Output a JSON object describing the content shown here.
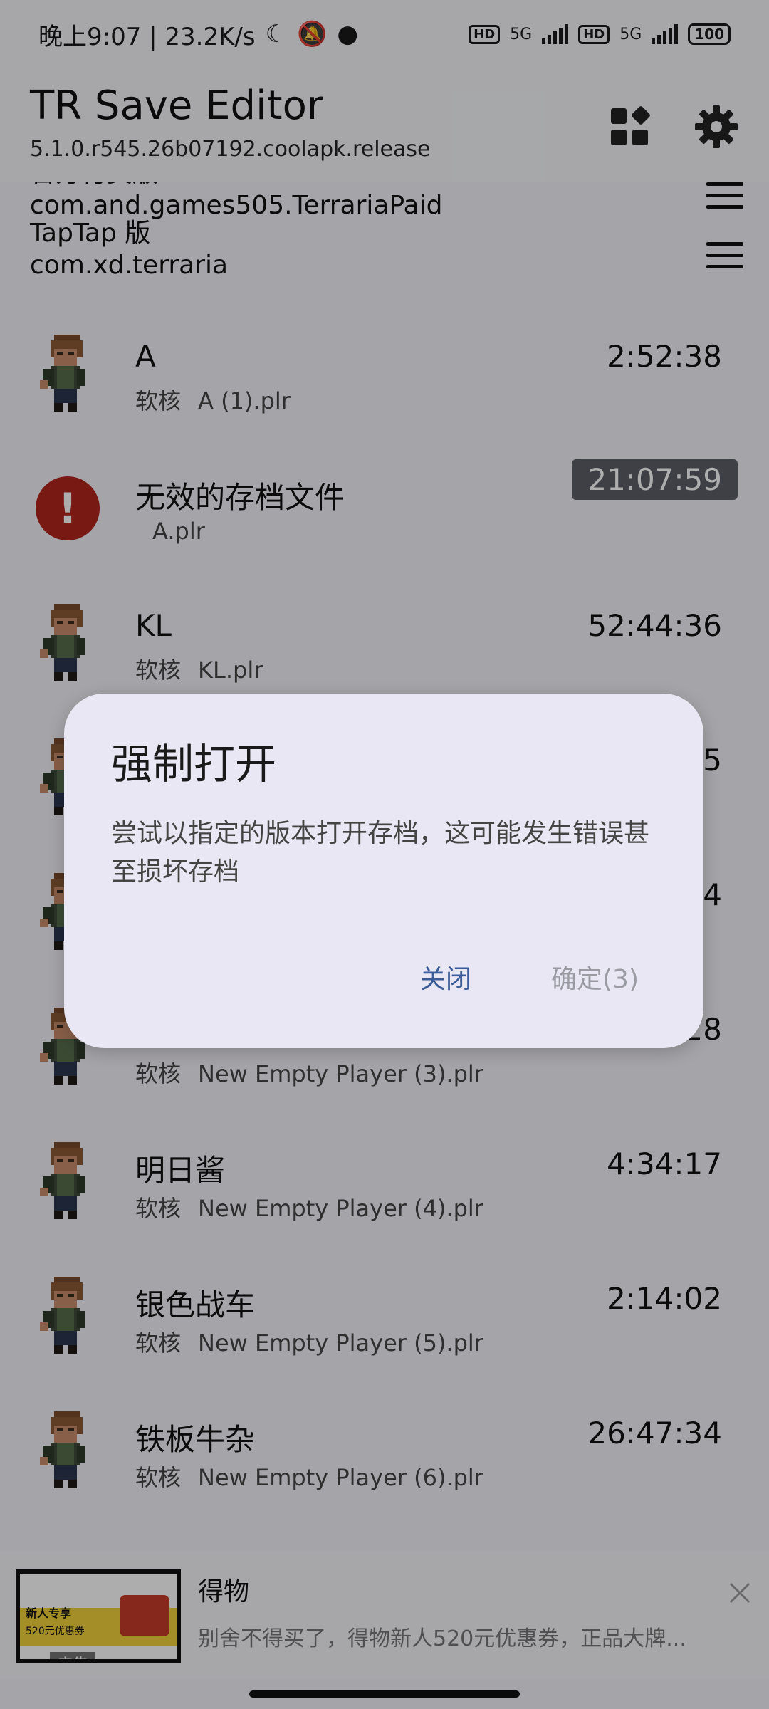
{
  "status_bar": {
    "time_speed": "晚上9:07 | 23.2K/s",
    "net1": "5G",
    "net2": "5G",
    "hd": "HD",
    "battery": "100"
  },
  "appbar": {
    "title": "TR Save Editor",
    "subtitle": "5.1.0.r545.26b07192.coolapk.release"
  },
  "folders": [
    {
      "label": "官方付费版",
      "package": "com.and.games505.TerrariaPaid"
    },
    {
      "label": "TapTap 版",
      "package": "com.xd.terraria"
    }
  ],
  "players": [
    {
      "name": "A",
      "mode": "软核",
      "file": "A (1).plr",
      "time": "2:52:38"
    },
    {
      "name": "无效的存档文件",
      "mode": "",
      "file": "A.plr",
      "time": "21:07:59",
      "invalid": true
    },
    {
      "name": "KL",
      "mode": "软核",
      "file": "KL.plr",
      "time": "52:44:36"
    },
    {
      "name": "",
      "mode": "",
      "file": "",
      "time": "5"
    },
    {
      "name": "",
      "mode": "",
      "file": "",
      "time": "4"
    },
    {
      "name": "",
      "mode": "软核",
      "file": "New Empty Player (3).plr",
      "time": "28"
    },
    {
      "name": "明日酱",
      "mode": "软核",
      "file": "New Empty Player (4).plr",
      "time": "4:34:17"
    },
    {
      "name": "银色战车",
      "mode": "软核",
      "file": "New Empty Player (5).plr",
      "time": "2:14:02"
    },
    {
      "name": "铁板牛杂",
      "mode": "软核",
      "file": "New Empty Player (6).plr",
      "time": "26:47:34"
    }
  ],
  "ad": {
    "title": "得物",
    "description": "别舍不得买了，得物新人520元优惠券，正品大牌...",
    "thumb_line1": "新人专享",
    "thumb_line2": "520元优惠券",
    "tag": "广告"
  },
  "dialog": {
    "title": "强制打开",
    "body": "尝试以指定的版本打开存档，这可能发生错误甚至损坏存档",
    "close_label": "关闭",
    "ok_label": "确定(3)"
  },
  "colors": {
    "error": "#b3261e",
    "primary_text_button": "#3a5a98",
    "disabled_button": "#9a9aa2",
    "dialog_surface": "#e8e7f3"
  }
}
